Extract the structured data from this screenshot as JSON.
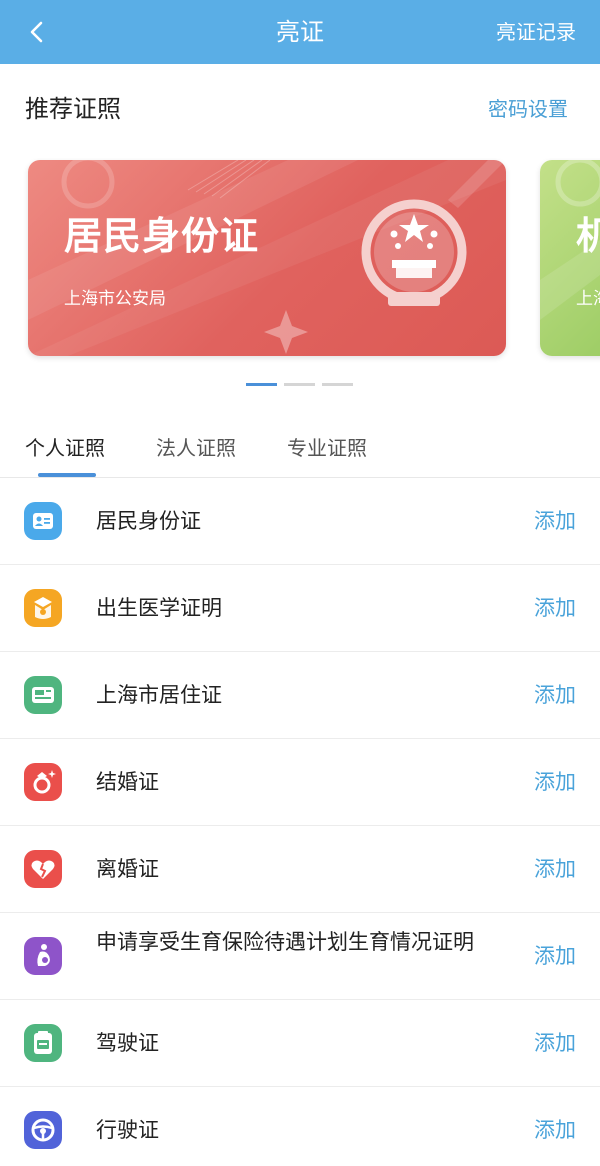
{
  "nav": {
    "title": "亮证",
    "right_label": "亮证记录",
    "back_icon": "chevron-left-icon",
    "background": "#5aaee6"
  },
  "recommend": {
    "title": "推荐证照",
    "password_link": "密码设置"
  },
  "cards": [
    {
      "title": "居民身份证",
      "issuer": "上海市公安局",
      "color": "#e0625e"
    },
    {
      "title": "机",
      "issuer": "上海",
      "color": "#96c95e"
    }
  ],
  "carousel_dots": {
    "count": 3,
    "active_index": 0
  },
  "tabs": [
    {
      "label": "个人证照",
      "active": true
    },
    {
      "label": "法人证照",
      "active": false
    },
    {
      "label": "专业证照",
      "active": false
    }
  ],
  "items": [
    {
      "label": "居民身份证",
      "action": "添加",
      "icon": "id-card-icon",
      "icon_color": "#4aa9ea"
    },
    {
      "label": "出生医学证明",
      "action": "添加",
      "icon": "baby-icon",
      "icon_color": "#f5a623"
    },
    {
      "label": "上海市居住证",
      "action": "添加",
      "icon": "residence-card-icon",
      "icon_color": "#4fb57f"
    },
    {
      "label": "结婚证",
      "action": "添加",
      "icon": "ring-icon",
      "icon_color": "#ea4f4b"
    },
    {
      "label": "离婚证",
      "action": "添加",
      "icon": "broken-heart-icon",
      "icon_color": "#ea4f4b"
    },
    {
      "label": "申请享受生育保险待遇计划生育情况证明",
      "action": "添加",
      "icon": "pregnancy-icon",
      "icon_color": "#8e54c9"
    },
    {
      "label": "驾驶证",
      "action": "添加",
      "icon": "driving-license-icon",
      "icon_color": "#4fb57f"
    },
    {
      "label": "行驶证",
      "action": "添加",
      "icon": "steering-wheel-icon",
      "icon_color": "#5163d9"
    }
  ],
  "colors": {
    "accent": "#4a90d9",
    "link": "#4aa3da"
  }
}
